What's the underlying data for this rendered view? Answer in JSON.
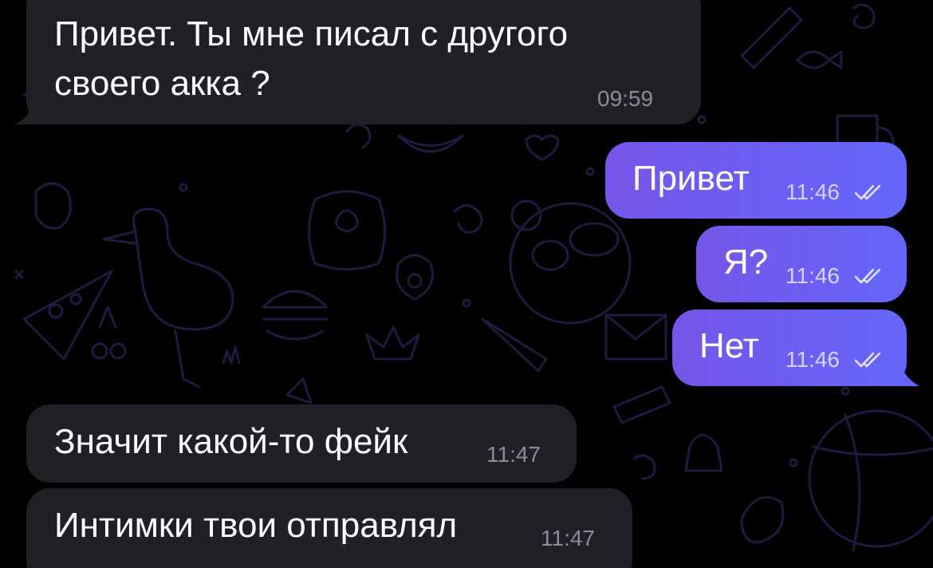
{
  "conversation": {
    "messages": [
      {
        "direction": "incoming",
        "lines": [
          "Привет.  Ты мне писал с другого",
          "своего акка ?"
        ],
        "time": "09:59"
      },
      {
        "direction": "outgoing",
        "text": "Привет",
        "time": "11:46",
        "status_icon": "double-check-icon"
      },
      {
        "direction": "outgoing",
        "text": "Я?",
        "time": "11:46",
        "status_icon": "double-check-icon"
      },
      {
        "direction": "outgoing",
        "text": "Нет",
        "time": "11:46",
        "status_icon": "double-check-icon"
      },
      {
        "direction": "incoming",
        "text": "Значит какой-то фейк",
        "time": "11:47"
      },
      {
        "direction": "incoming",
        "text": "Интимки твои отправлял",
        "time": "11:47"
      }
    ]
  },
  "colors": {
    "background": "#000000",
    "incoming_bubble": "#212027",
    "outgoing_bubble_start": "#7656ea",
    "outgoing_bubble_end": "#6466fb",
    "wallpaper_doodle": "#1c1a3a"
  }
}
